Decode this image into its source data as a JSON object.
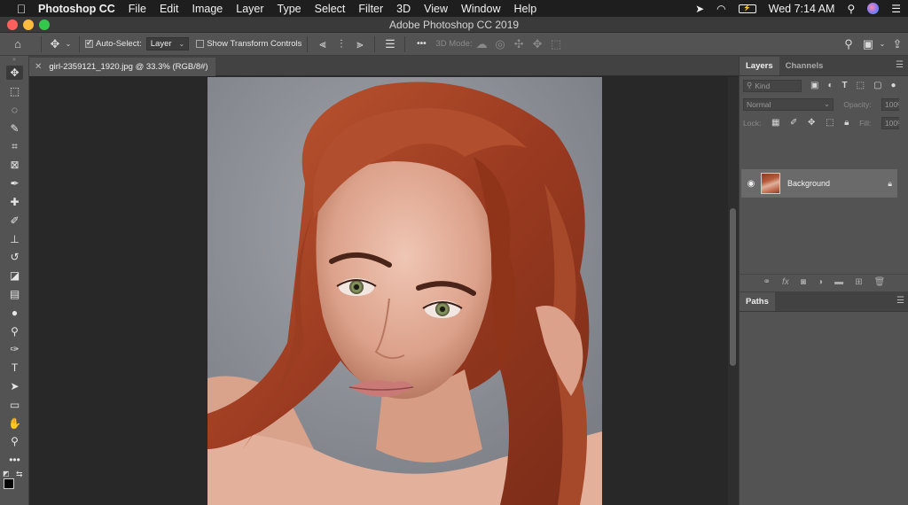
{
  "menubar": {
    "app_name": "Photoshop CC",
    "items": [
      "File",
      "Edit",
      "Image",
      "Layer",
      "Type",
      "Select",
      "Filter",
      "3D",
      "View",
      "Window",
      "Help"
    ],
    "clock": "Wed 7:14 AM",
    "icons": [
      "apple-icon",
      "location-icon",
      "wifi-icon",
      "battery-icon",
      "search-icon",
      "siri-icon",
      "list-icon"
    ]
  },
  "window": {
    "title": "Adobe Photoshop CC 2019"
  },
  "options": {
    "auto_select_label": "Auto-Select:",
    "auto_select_checked": true,
    "auto_select_target": "Layer",
    "show_transform_label": "Show Transform Controls",
    "show_transform_checked": false,
    "mode_3d_label": "3D Mode:",
    "more_label": "•••"
  },
  "tools": [
    {
      "name": "move-tool",
      "glyph": "✥"
    },
    {
      "name": "marquee-tool",
      "glyph": "⬚"
    },
    {
      "name": "lasso-tool",
      "glyph": "◌"
    },
    {
      "name": "quick-select-tool",
      "glyph": "✎"
    },
    {
      "name": "crop-tool",
      "glyph": "⌗"
    },
    {
      "name": "frame-tool",
      "glyph": "⊠"
    },
    {
      "name": "eyedropper-tool",
      "glyph": "✒"
    },
    {
      "name": "healing-tool",
      "glyph": "✚"
    },
    {
      "name": "brush-tool",
      "glyph": "✐"
    },
    {
      "name": "stamp-tool",
      "glyph": "⊥"
    },
    {
      "name": "history-brush-tool",
      "glyph": "↺"
    },
    {
      "name": "eraser-tool",
      "glyph": "◪"
    },
    {
      "name": "gradient-tool",
      "glyph": "▤"
    },
    {
      "name": "blur-tool",
      "glyph": "●"
    },
    {
      "name": "dodge-tool",
      "glyph": "⚲"
    },
    {
      "name": "pen-tool",
      "glyph": "✑"
    },
    {
      "name": "type-tool",
      "glyph": "T"
    },
    {
      "name": "path-select-tool",
      "glyph": "➤"
    },
    {
      "name": "shape-tool",
      "glyph": "▭"
    },
    {
      "name": "hand-tool",
      "glyph": "✋"
    },
    {
      "name": "zoom-tool",
      "glyph": "⚲"
    },
    {
      "name": "edit-toolbar",
      "glyph": "•••"
    }
  ],
  "document": {
    "tab_title": "girl-2359121_1920.jpg @ 33.3% (RGB/8#)"
  },
  "layers_panel": {
    "tabs": [
      "Layers",
      "Channels"
    ],
    "kind_placeholder": "Kind",
    "blend_mode": "Normal",
    "opacity_label": "Opacity:",
    "opacity_value": "100%",
    "lock_label": "Lock:",
    "fill_label": "Fill:",
    "fill_value": "100%",
    "layers": [
      {
        "name": "Background",
        "visible": true,
        "locked": true
      }
    ]
  },
  "paths_panel": {
    "title": "Paths"
  },
  "colors": {
    "foreground": "#000000",
    "canvas_background": "#8e9097",
    "hair": "#a8472a",
    "skin": "#e6b3a0"
  }
}
